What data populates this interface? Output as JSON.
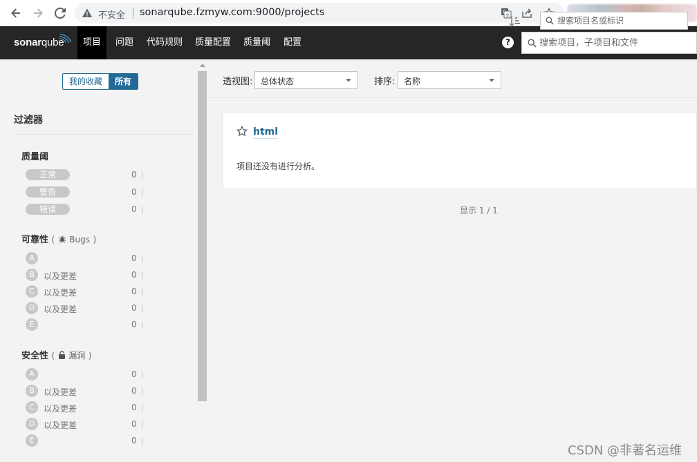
{
  "browser": {
    "security_label": "不安全",
    "url": "sonarqube.fzmyw.com:9000/projects",
    "icons": [
      "back-arrow-icon",
      "forward-arrow-icon",
      "reload-icon",
      "warning-icon",
      "translate-icon",
      "share-icon",
      "star-icon"
    ]
  },
  "topnav": {
    "logo_bold": "sonar",
    "logo_light": "qube",
    "items": [
      {
        "label": "项目",
        "active": true
      },
      {
        "label": "问题"
      },
      {
        "label": "代码规则"
      },
      {
        "label": "质量配置"
      },
      {
        "label": "质量阈"
      },
      {
        "label": "配置"
      }
    ],
    "help": "?",
    "search_placeholder": "搜索项目，子项目和文件"
  },
  "sidebar": {
    "toggle": {
      "favorites": "我的收藏",
      "all": "所有"
    },
    "filter_title": "过滤器",
    "quality_gate": {
      "title": "质量阈",
      "items": [
        {
          "label": "正常",
          "count": "0"
        },
        {
          "label": "警告",
          "count": "0"
        },
        {
          "label": "错误",
          "count": "0"
        }
      ]
    },
    "reliability": {
      "title": "可靠性",
      "paren_open": "(",
      "sub": "Bugs",
      "paren_close": ")",
      "items": [
        {
          "grade": "A",
          "label": "",
          "count": "0"
        },
        {
          "grade": "B",
          "label": "以及更差",
          "count": "0"
        },
        {
          "grade": "C",
          "label": "以及更差",
          "count": "0"
        },
        {
          "grade": "D",
          "label": "以及更差",
          "count": "0"
        },
        {
          "grade": "E",
          "label": "",
          "count": "0"
        }
      ]
    },
    "security": {
      "title": "安全性",
      "paren_open": "(",
      "sub": "漏洞",
      "paren_close": ")",
      "items": [
        {
          "grade": "A",
          "label": "",
          "count": "0"
        },
        {
          "grade": "B",
          "label": "以及更差",
          "count": "0"
        },
        {
          "grade": "C",
          "label": "以及更差",
          "count": "0"
        },
        {
          "grade": "D",
          "label": "以及更差",
          "count": "0"
        },
        {
          "grade": "E",
          "label": "",
          "count": "0"
        }
      ]
    }
  },
  "toolbar": {
    "perspective_label": "透视图:",
    "perspective_value": "总体状态",
    "sort_label": "排序:",
    "sort_value": "名称",
    "search_placeholder": "搜索项目名或标识"
  },
  "project": {
    "name": "html",
    "message": "项目还没有进行分析。"
  },
  "paging": "显示 1 / 1",
  "watermark": "CSDN @非著名运维",
  "colors": {
    "nav_bg": "#262626",
    "accent": "#236a97",
    "grade_gray": "#c8c8c8"
  }
}
